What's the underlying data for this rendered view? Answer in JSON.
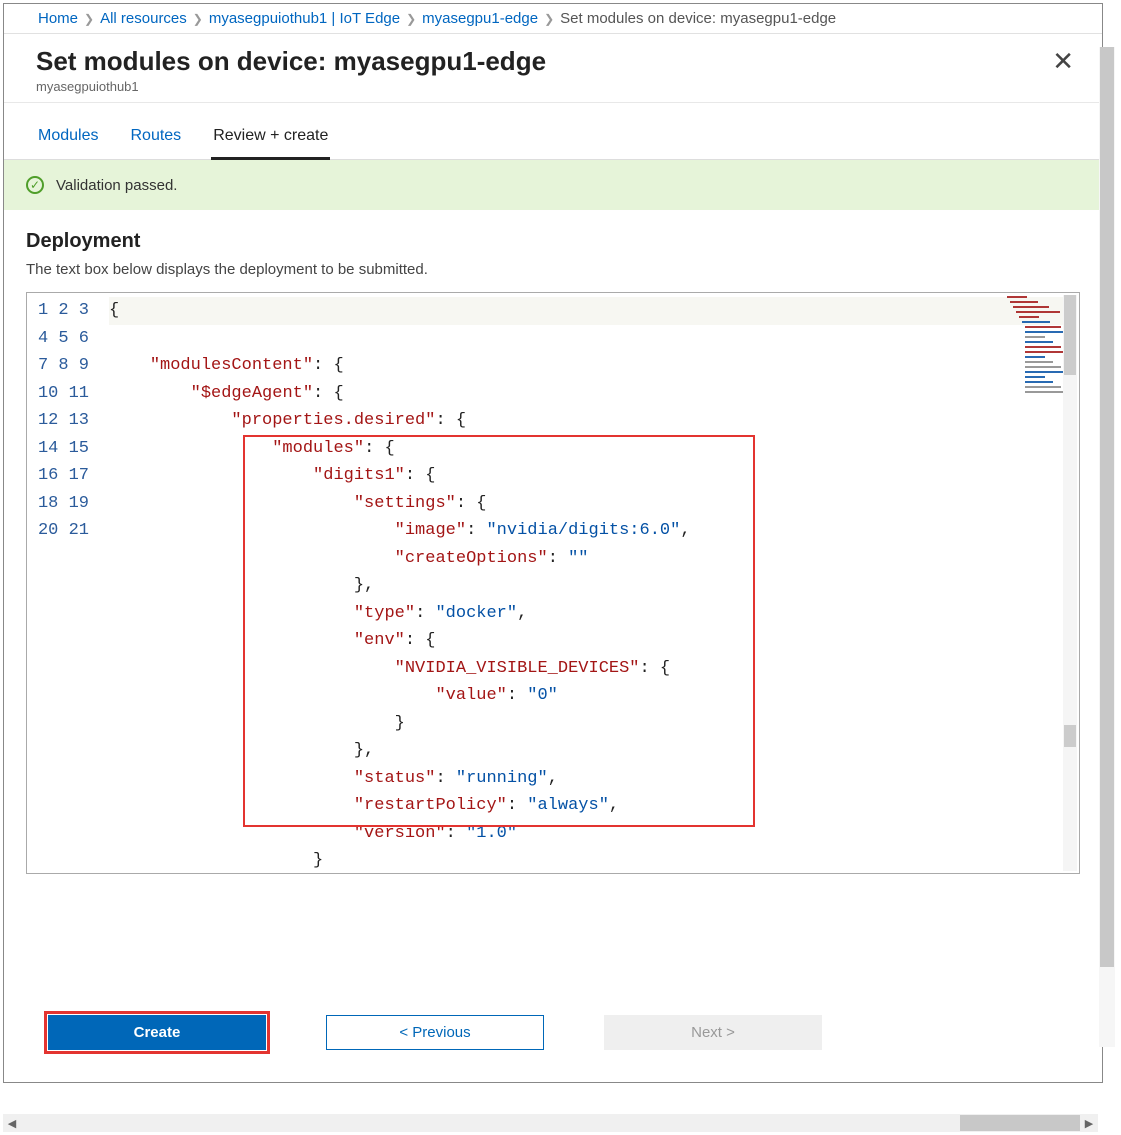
{
  "breadcrumb": {
    "items": [
      {
        "label": "Home",
        "current": false
      },
      {
        "label": "All resources",
        "current": false
      },
      {
        "label": "myasegpuiothub1 | IoT Edge",
        "current": false
      },
      {
        "label": "myasegpu1-edge",
        "current": false
      },
      {
        "label": "Set modules on device: myasegpu1-edge",
        "current": true
      }
    ]
  },
  "header": {
    "title": "Set modules on device: myasegpu1-edge",
    "subtitle": "myasegpuiothub1"
  },
  "tabs": {
    "items": [
      {
        "label": "Modules",
        "active": false
      },
      {
        "label": "Routes",
        "active": false
      },
      {
        "label": "Review + create",
        "active": true
      }
    ]
  },
  "validation": {
    "text": "Validation passed."
  },
  "deployment": {
    "heading": "Deployment",
    "description": "The text box below displays the deployment to be submitted."
  },
  "editor": {
    "line_count_visible": 21,
    "highlighted_range": {
      "start": 6,
      "end": 19
    },
    "json_content": {
      "modulesContent": {
        "$edgeAgent": {
          "properties.desired": {
            "modules": {
              "digits1": {
                "settings": {
                  "image": "nvidia/digits:6.0",
                  "createOptions": ""
                },
                "type": "docker",
                "env": {
                  "NVIDIA_VISIBLE_DEVICES": {
                    "value": "0"
                  }
                },
                "status": "running",
                "restartPolicy": "always",
                "version": "1.0"
              }
            }
          }
        }
      }
    }
  },
  "footer": {
    "create": "Create",
    "previous": "< Previous",
    "next": "Next >"
  }
}
